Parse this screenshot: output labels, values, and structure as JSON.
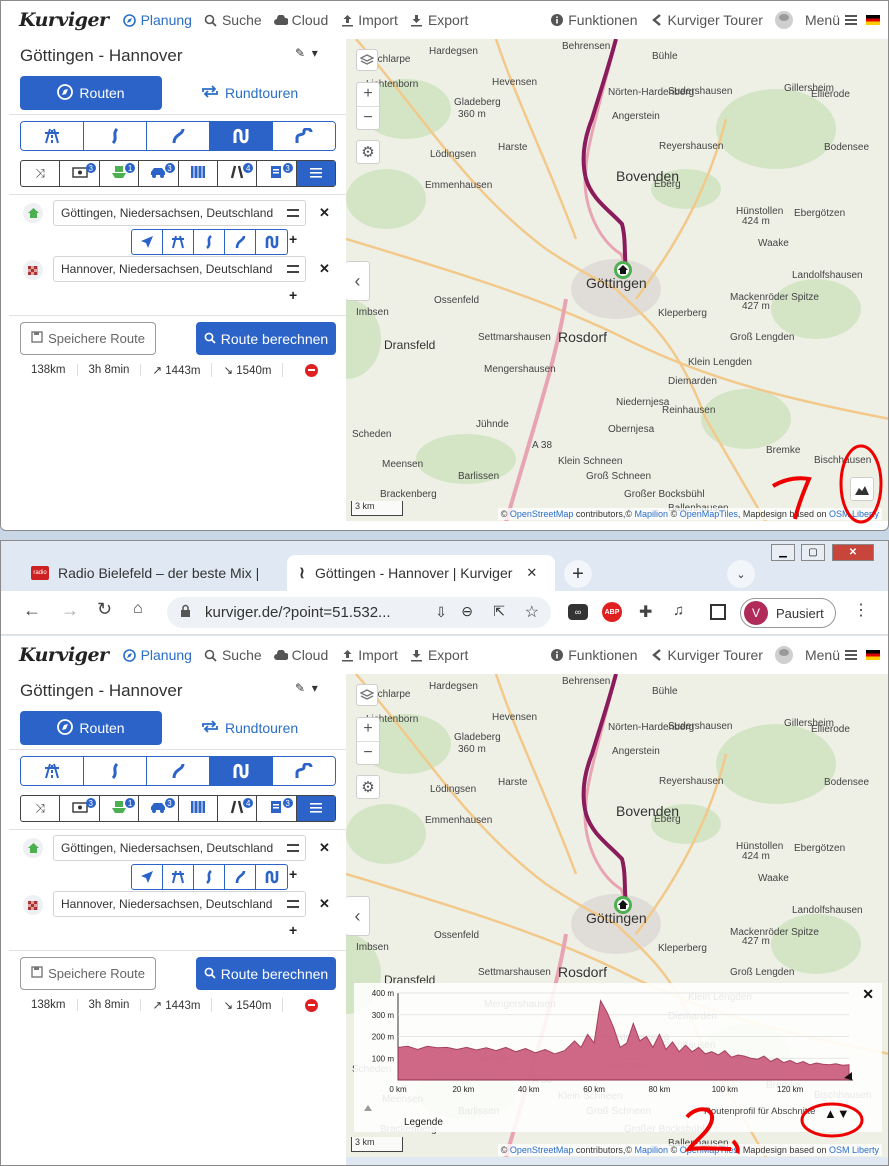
{
  "app": {
    "logo": "Kurviger",
    "nav": [
      {
        "label": "Planung",
        "icon": "compass-icon"
      },
      {
        "label": "Suche",
        "icon": "search-icon"
      },
      {
        "label": "Cloud",
        "icon": "cloud-icon"
      },
      {
        "label": "Import",
        "icon": "upload-icon"
      },
      {
        "label": "Export",
        "icon": "download-icon"
      }
    ],
    "nav_right": [
      {
        "label": "Funktionen",
        "icon": "info-icon"
      },
      {
        "label": "Kurviger Tourer",
        "icon": "tourer-icon"
      },
      {
        "label": "Menü",
        "icon": "hamburger-icon"
      }
    ]
  },
  "route": {
    "title": "Göttingen - Hannover",
    "tab_routen": "Routen",
    "tab_rundtouren": "Rundtouren",
    "start": "Göttingen, Niedersachsen, Deutschland",
    "end": "Hannover, Niedersachsen, Deutschland",
    "option_badges": [
      "3",
      "1",
      "3",
      "",
      "4",
      "3"
    ],
    "save_label": "Speichere Route",
    "calc_label": "Route berechnen",
    "stats": {
      "distance": "138km",
      "time": "3h 8min",
      "ascent": "↗ 1443m",
      "descent": "↘ 1540m"
    }
  },
  "map": {
    "labels": [
      "Hardegsen",
      "Behrensen",
      "Bühle",
      "Schlarpe",
      "Lichtenborn",
      "Hevensen",
      "Gladeberg",
      "360 m",
      "Sudershausen",
      "Gillersheim",
      "Ellierode",
      "Nörten-Hardenberg",
      "Angerstein",
      "Harste",
      "Reyershausen",
      "Bodensee",
      "Lödingsen",
      "Bovenden",
      "Eberg",
      "Emmenhausen",
      "Hünstollen",
      "424 m",
      "Ebergötzen",
      "Waake",
      "Göttingen",
      "Landolfshausen",
      "Ossenfeld",
      "Mackenröder Spitze",
      "427 m",
      "Kleperberg",
      "Imbsen",
      "Rosdorf",
      "Groß Lengden",
      "Settmarshausen",
      "Dransfeld",
      "Klein Lengden",
      "Mengershausen",
      "Diemarden",
      "Niedernjesa",
      "Reinhausen",
      "Jühnde",
      "Obernjesa",
      "Scheden",
      "Bremke",
      "Bischhausen",
      "Klein Schneen",
      "Meensen",
      "Barlissen",
      "Groß Schneen",
      "Brackenberg",
      "Großer Bocksbühl",
      "Ballenhausen",
      "A 38"
    ],
    "scale": "3 km",
    "attribution": {
      "pre": "© ",
      "osm": "OpenStreetMap",
      "mid": " contributors,© ",
      "mapilion": "Mapilion",
      "sep": " © ",
      "tiles": "OpenMapTiles",
      "tail": ", Mapdesign based on ",
      "liberty": "OSM Liberty"
    }
  },
  "browser": {
    "tabs": [
      "Radio Bielefeld – der beste Mix |",
      "Göttingen - Hannover | Kurviger"
    ],
    "url": "kurviger.de/?point=51.532...",
    "profile_initial": "V",
    "profile_status": "Pausiert",
    "abp": "ABP"
  },
  "elevation": {
    "y_ticks": [
      "400 m",
      "300 m",
      "200 m",
      "100 m"
    ],
    "x_ticks": [
      "0 km",
      "20 km",
      "40 km",
      "60 km",
      "80 km",
      "100 km",
      "120 km"
    ],
    "legend": "Legende",
    "profile_label": "Routenprofil für Abschnitte",
    "toggle": "▲▼"
  },
  "chart_data": {
    "type": "area",
    "xlabel": "",
    "ylabel": "",
    "xlim": [
      0,
      138
    ],
    "ylim": [
      0,
      400
    ],
    "x": [
      0,
      3,
      6,
      9,
      12,
      15,
      18,
      21,
      24,
      27,
      30,
      33,
      36,
      39,
      42,
      45,
      48,
      51,
      54,
      56,
      58,
      60,
      62,
      64,
      66,
      68,
      70,
      72,
      74,
      76,
      78,
      80,
      82,
      84,
      86,
      88,
      90,
      92,
      94,
      96,
      98,
      100,
      102,
      104,
      106,
      108,
      110,
      112,
      114,
      116,
      118,
      120,
      122,
      124,
      126,
      128,
      130,
      132,
      134,
      136,
      138
    ],
    "values": [
      150,
      155,
      140,
      155,
      148,
      150,
      140,
      150,
      138,
      148,
      135,
      150,
      130,
      145,
      125,
      140,
      120,
      135,
      180,
      150,
      210,
      170,
      365,
      310,
      240,
      150,
      170,
      260,
      180,
      200,
      150,
      210,
      140,
      175,
      130,
      160,
      130,
      150,
      120,
      130,
      115,
      135,
      105,
      115,
      110,
      100,
      95,
      110,
      85,
      100,
      80,
      90,
      75,
      85,
      70,
      78,
      72,
      70,
      75,
      68,
      70
    ]
  },
  "annotations": {
    "one": "1",
    "two": "2"
  }
}
